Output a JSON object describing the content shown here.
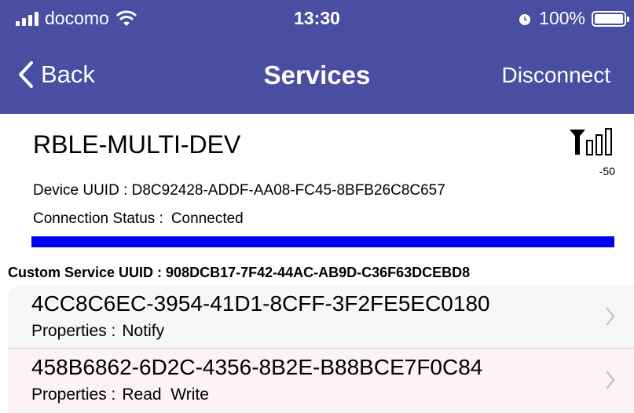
{
  "status_bar": {
    "carrier": "docomo",
    "time": "13:30",
    "battery": "100%"
  },
  "nav": {
    "back_label": "Back",
    "title": "Services",
    "right_button": "Disconnect"
  },
  "device": {
    "name": "RBLE-MULTI-DEV",
    "rssi": "-50",
    "uuid_label": "Device UUID : D8C92428-ADDF-AA08-FC45-8BFB26C8C657",
    "status_label": "Connection Status :",
    "status_value": "Connected",
    "progress": 1.0
  },
  "service": {
    "header": "Custom Service  UUID : 908DCB17-7F42-44AC-AB9D-C36F63DCEBD8",
    "characteristics": [
      {
        "uuid": "4CC8C6EC-3954-41D1-8CFF-3F2FE5EC0180",
        "props_label": "Properties :",
        "props": "Notify"
      },
      {
        "uuid": "458B6862-6D2C-4356-8B2E-B88BCE7F0C84",
        "props_label": "Properties :",
        "props": "Read  Write"
      }
    ]
  },
  "colors": {
    "header_bg": "#4a4ea3",
    "progress": "#0000ee",
    "row_alt_bg": "#fdf2f5"
  },
  "icons": [
    "signal-icon",
    "wifi-icon",
    "alarm-icon",
    "battery-icon",
    "back-chevron-icon",
    "rssi-antenna-icon",
    "chevron-right-icon"
  ]
}
